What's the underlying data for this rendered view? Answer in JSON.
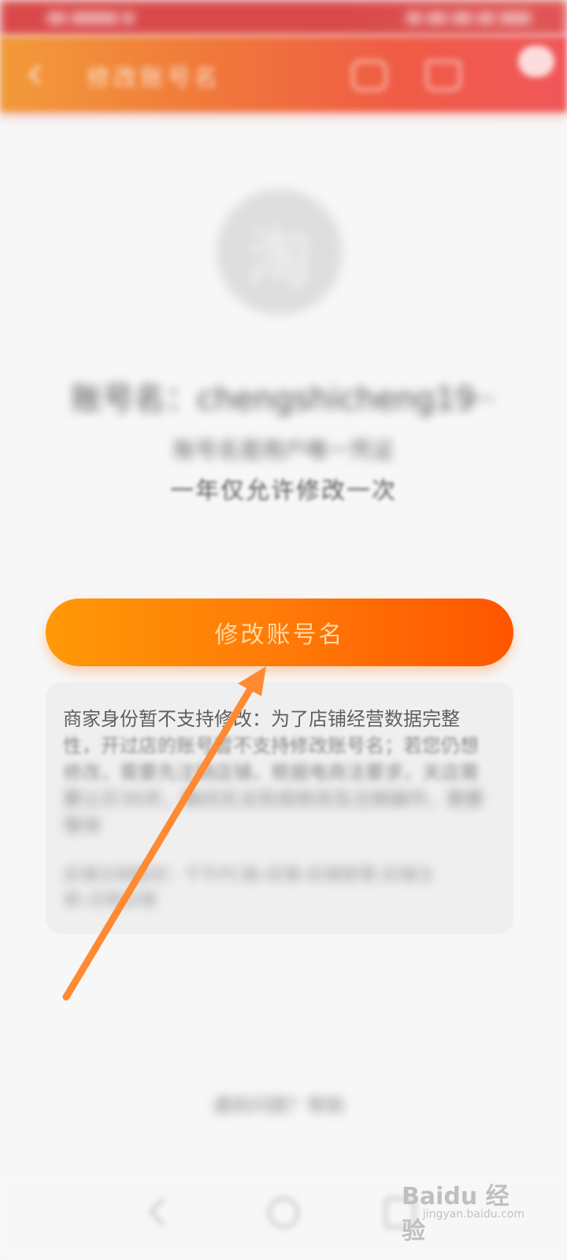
{
  "status_bar": {},
  "header": {
    "title": "修改账号名"
  },
  "profile": {
    "avatar_text": "淘",
    "account_label": "账号名：chengshicheng19··",
    "subtitle": "账号名是用户唯一凭证",
    "note": "一年仅允许修改一次"
  },
  "action": {
    "modify_button_label": "修改账号名"
  },
  "info_card": {
    "line1": "商家身份暂不支持修改：为了店铺经营数据完整",
    "line2": "性，开过店的账号暂不支持修改账号名；若您仍想",
    "line3": "修改，需要先注销店铺，根据电商法要求，关店需",
    "line4": "要公示30天，期间无法完成修改及注销操作，需要",
    "line5": "等待",
    "sub1": "店铺注销路径：千牛PC端-店铺-店铺管理-店铺注",
    "sub2": "销-注销店铺"
  },
  "footer": {
    "link_label": "遇到问题？帮助"
  },
  "watermark": {
    "logo": "Baidu 经验",
    "url": "jingyan.baidu.com"
  },
  "colors": {
    "header_start": "#f29a3a",
    "header_end": "#f0565a",
    "button_start": "#ff9806",
    "button_end": "#ff5500",
    "arrow": "#ff8a33"
  },
  "icons": [
    "back-icon",
    "share-icon",
    "home-icon",
    "chat-icon",
    "nav-back-icon",
    "nav-home-icon",
    "nav-recent-icon"
  ]
}
